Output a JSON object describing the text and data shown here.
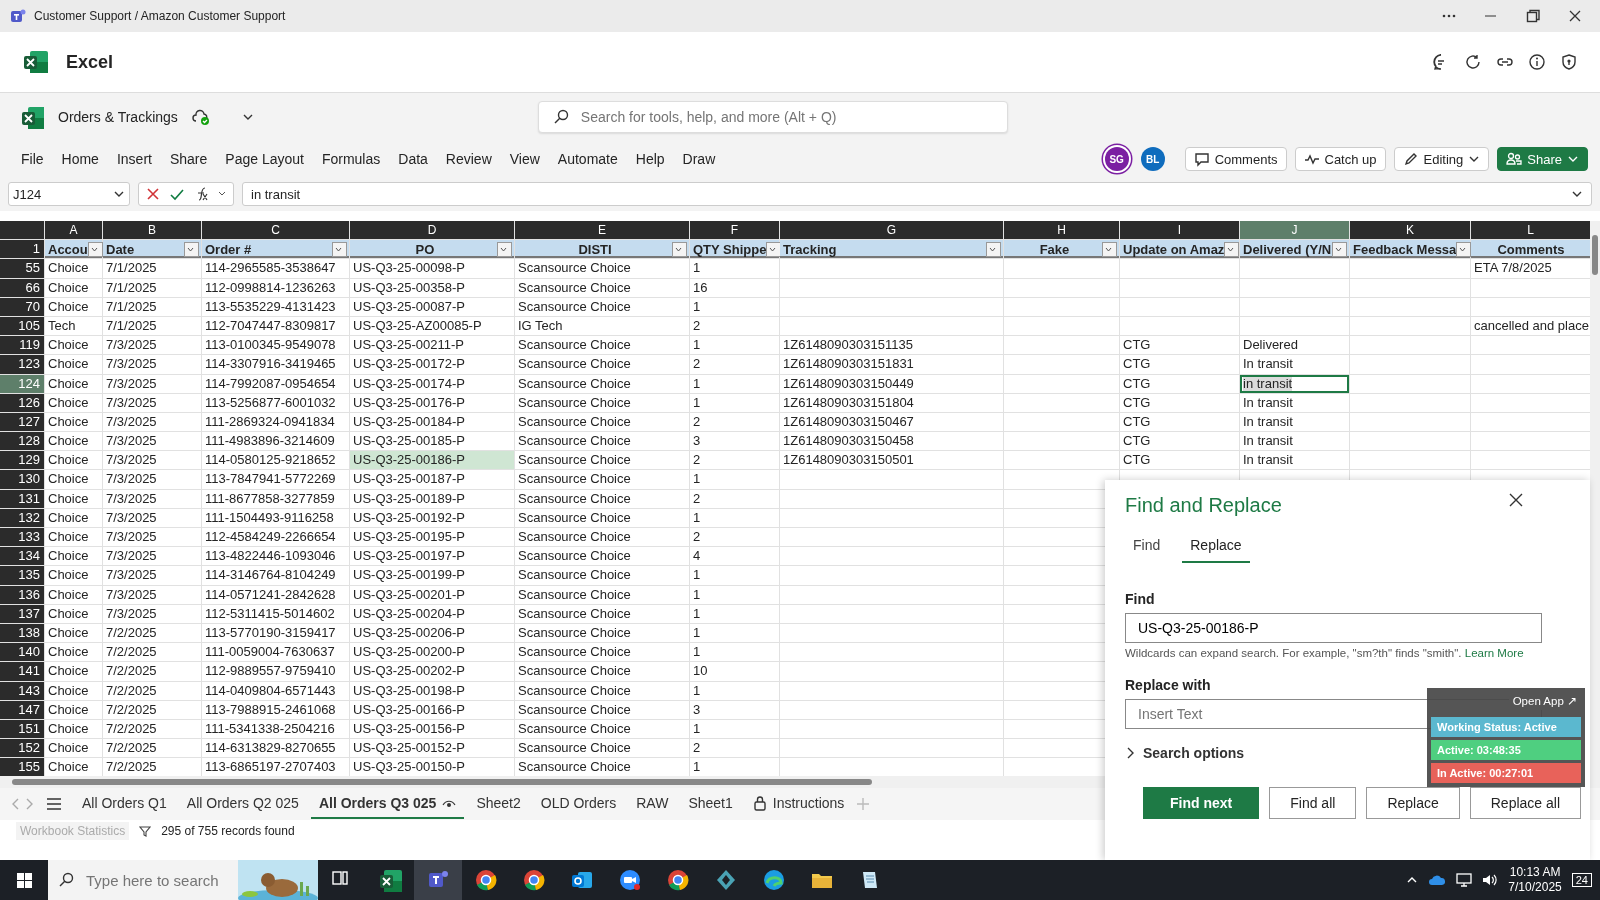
{
  "window": {
    "title": "Customer Support / Amazon Customer Support"
  },
  "app": {
    "name": "Excel"
  },
  "document": {
    "name": "Orders & Trackings",
    "search": {
      "placeholder": "Search for tools, help, and more (Alt + Q)"
    }
  },
  "menu": [
    {
      "label": "File"
    },
    {
      "label": "Home"
    },
    {
      "label": "Insert"
    },
    {
      "label": "Share"
    },
    {
      "label": "Page Layout"
    },
    {
      "label": "Formulas"
    },
    {
      "label": "Data"
    },
    {
      "label": "Review"
    },
    {
      "label": "View"
    },
    {
      "label": "Automate"
    },
    {
      "label": "Help"
    },
    {
      "label": "Draw"
    }
  ],
  "avatars": [
    {
      "initials": "SG",
      "color": "#7b1fa2"
    },
    {
      "initials": "BL",
      "color": "#0f6cbd"
    }
  ],
  "actions": [
    {
      "label": "Comments",
      "kind": "comment"
    },
    {
      "label": "Catch up",
      "kind": "pulse"
    },
    {
      "label": "Editing",
      "kind": "pencil"
    },
    {
      "label": "Share",
      "kind": "share"
    }
  ],
  "formula_bar": {
    "cell": "J124",
    "value": "in transit"
  },
  "sheet": {
    "columns": [
      {
        "letter": "A",
        "selected": false
      },
      {
        "letter": "B",
        "selected": false
      },
      {
        "letter": "C",
        "selected": false
      },
      {
        "letter": "D",
        "selected": false
      },
      {
        "letter": "E",
        "selected": false
      },
      {
        "letter": "F",
        "selected": false
      },
      {
        "letter": "G",
        "selected": false
      },
      {
        "letter": "H",
        "selected": false
      },
      {
        "letter": "I",
        "selected": false
      },
      {
        "letter": "J",
        "selected": true
      },
      {
        "letter": "K",
        "selected": false
      },
      {
        "letter": "L",
        "selected": false
      }
    ],
    "header_row": {
      "row": "1",
      "cells": [
        {
          "text": "Accou",
          "filter": true,
          "kind": "left"
        },
        {
          "text": "Date",
          "filter": true,
          "kind": "left"
        },
        {
          "text": "Order #",
          "filter": true,
          "kind": "left"
        },
        {
          "text": "PO",
          "filter": true,
          "kind": "centered"
        },
        {
          "text": "DISTI",
          "filter": true,
          "kind": "centered"
        },
        {
          "text": "QTY Shippe",
          "filter": true,
          "kind": "left"
        },
        {
          "text": "Tracking",
          "filter": true,
          "kind": "left"
        },
        {
          "text": "Fake",
          "filter": true,
          "kind": "centered"
        },
        {
          "text": "Update on Amaz",
          "filter": true,
          "kind": "left"
        },
        {
          "text": "Delivered (Y/N",
          "filter": true,
          "kind": "left"
        },
        {
          "text": "Feedback Messa",
          "filter": true,
          "kind": "left"
        },
        {
          "text": "Comments",
          "filter": false,
          "kind": "centered"
        }
      ]
    },
    "rows": [
      {
        "row": "55",
        "selected": false,
        "cells": [
          "Choice",
          "7/1/2025",
          "114-2965585-3538647",
          "US-Q3-25-00098-P",
          "Scansource Choice",
          "1",
          "",
          "",
          "",
          "",
          "",
          "ETA 7/8/2025"
        ]
      },
      {
        "row": "66",
        "selected": false,
        "cells": [
          "Choice",
          "7/1/2025",
          "112-0998814-1236263",
          "US-Q3-25-00358-P",
          "Scansource Choice",
          "16",
          "",
          "",
          "",
          "",
          "",
          ""
        ]
      },
      {
        "row": "70",
        "selected": false,
        "cells": [
          "Choice",
          "7/1/2025",
          "113-5535229-4131423",
          "US-Q3-25-00087-P",
          "Scansource Choice",
          "1",
          "",
          "",
          "",
          "",
          "",
          ""
        ]
      },
      {
        "row": "105",
        "selected": false,
        "cells": [
          "Tech",
          "7/1/2025",
          "112-7047447-8309817",
          "US-Q3-25-AZ00085-P",
          "IG Tech",
          "2",
          "",
          "",
          "",
          "",
          "",
          "cancelled and place"
        ]
      },
      {
        "row": "119",
        "selected": false,
        "cells": [
          "Choice",
          "7/3/2025",
          "113-0100345-9549078",
          "US-Q3-25-00211-P",
          "Scansource Choice",
          "1",
          "1Z6148090303151135",
          "",
          "CTG",
          "Delivered",
          "",
          ""
        ]
      },
      {
        "row": "123",
        "selected": false,
        "cells": [
          "Choice",
          "7/3/2025",
          "114-3307916-3419465",
          "US-Q3-25-00172-P",
          "Scansource Choice",
          "2",
          "1Z6148090303151831",
          "",
          "CTG",
          "In transit",
          "",
          ""
        ]
      },
      {
        "row": "124",
        "selected": true,
        "cells": [
          "Choice",
          "7/3/2025",
          "114-7992087-0954654",
          "US-Q3-25-00174-P",
          "Scansource Choice",
          "1",
          "1Z6148090303150449",
          "",
          "CTG",
          {
            "text": "in transit",
            "active": true
          },
          "",
          ""
        ]
      },
      {
        "row": "126",
        "selected": false,
        "cells": [
          "Choice",
          "7/3/2025",
          "113-5256877-6001032",
          "US-Q3-25-00176-P",
          "Scansource Choice",
          "1",
          "1Z6148090303151804",
          "",
          "CTG",
          "In transit",
          "",
          ""
        ]
      },
      {
        "row": "127",
        "selected": false,
        "cells": [
          "Choice",
          "7/3/2025",
          "111-2869324-0941834",
          "US-Q3-25-00184-P",
          "Scansource Choice",
          "2",
          "1Z6148090303150467",
          "",
          "CTG",
          "In transit",
          "",
          ""
        ]
      },
      {
        "row": "128",
        "selected": false,
        "cells": [
          "Choice",
          "7/3/2025",
          "111-4983896-3214609",
          "US-Q3-25-00185-P",
          "Scansource Choice",
          "3",
          "1Z6148090303150458",
          "",
          "CTG",
          "In transit",
          "",
          ""
        ]
      },
      {
        "row": "129",
        "selected": false,
        "cells": [
          "Choice",
          "7/3/2025",
          "114-0580125-9218652",
          {
            "text": "US-Q3-25-00186-P",
            "found": true
          },
          "Scansource Choice",
          "2",
          "1Z6148090303150501",
          "",
          "CTG",
          "In transit",
          "",
          ""
        ]
      },
      {
        "row": "130",
        "selected": false,
        "cells": [
          "Choice",
          "7/3/2025",
          "113-7847941-5772269",
          "US-Q3-25-00187-P",
          "Scansource Choice",
          "1",
          "",
          "",
          "",
          "",
          "",
          ""
        ]
      },
      {
        "row": "131",
        "selected": false,
        "cells": [
          "Choice",
          "7/3/2025",
          "111-8677858-3277859",
          "US-Q3-25-00189-P",
          "Scansource Choice",
          "2",
          "",
          "",
          "",
          "",
          "",
          ""
        ]
      },
      {
        "row": "132",
        "selected": false,
        "cells": [
          "Choice",
          "7/3/2025",
          "111-1504493-9116258",
          "US-Q3-25-00192-P",
          "Scansource Choice",
          "1",
          "",
          "",
          "",
          "",
          "",
          ""
        ]
      },
      {
        "row": "133",
        "selected": false,
        "cells": [
          "Choice",
          "7/3/2025",
          "112-4584249-2266654",
          "US-Q3-25-00195-P",
          "Scansource Choice",
          "2",
          "",
          "",
          "",
          "",
          "",
          ""
        ]
      },
      {
        "row": "134",
        "selected": false,
        "cells": [
          "Choice",
          "7/3/2025",
          "113-4822446-1093046",
          "US-Q3-25-00197-P",
          "Scansource Choice",
          "4",
          "",
          "",
          "",
          "",
          "",
          ""
        ]
      },
      {
        "row": "135",
        "selected": false,
        "cells": [
          "Choice",
          "7/3/2025",
          "114-3146764-8104249",
          "US-Q3-25-00199-P",
          "Scansource Choice",
          "1",
          "",
          "",
          "",
          "",
          "",
          ""
        ]
      },
      {
        "row": "136",
        "selected": false,
        "cells": [
          "Choice",
          "7/3/2025",
          "114-0571241-2842628",
          "US-Q3-25-00201-P",
          "Scansource Choice",
          "1",
          "",
          "",
          "",
          "",
          "",
          ""
        ]
      },
      {
        "row": "137",
        "selected": false,
        "cells": [
          "Choice",
          "7/3/2025",
          "112-5311415-5014602",
          "US-Q3-25-00204-P",
          "Scansource Choice",
          "1",
          "",
          "",
          "",
          "",
          "",
          ""
        ]
      },
      {
        "row": "138",
        "selected": false,
        "cells": [
          "Choice",
          "7/2/2025",
          "113-5770190-3159417",
          "US-Q3-25-00206-P",
          "Scansource Choice",
          "1",
          "",
          "",
          "",
          "",
          "",
          ""
        ]
      },
      {
        "row": "140",
        "selected": false,
        "cells": [
          "Choice",
          "7/2/2025",
          "111-0059004-7630637",
          "US-Q3-25-00200-P",
          "Scansource Choice",
          "1",
          "",
          "",
          "",
          "",
          "",
          ""
        ]
      },
      {
        "row": "141",
        "selected": false,
        "cells": [
          "Choice",
          "7/2/2025",
          "112-9889557-9759410",
          "US-Q3-25-00202-P",
          "Scansource Choice",
          "10",
          "",
          "",
          "",
          "",
          "",
          ""
        ]
      },
      {
        "row": "143",
        "selected": false,
        "cells": [
          "Choice",
          "7/2/2025",
          "114-0409804-6571443",
          "US-Q3-25-00198-P",
          "Scansource Choice",
          "1",
          "",
          "",
          "",
          "",
          "",
          ""
        ]
      },
      {
        "row": "147",
        "selected": false,
        "cells": [
          "Choice",
          "7/2/2025",
          "113-7988915-2461068",
          "US-Q3-25-00166-P",
          "Scansource Choice",
          "3",
          "",
          "",
          "",
          "",
          "",
          ""
        ]
      },
      {
        "row": "151",
        "selected": false,
        "cells": [
          "Choice",
          "7/2/2025",
          "111-5341338-2504216",
          "US-Q3-25-00156-P",
          "Scansource Choice",
          "1",
          "",
          "",
          "",
          "",
          "",
          ""
        ]
      },
      {
        "row": "152",
        "selected": false,
        "cells": [
          "Choice",
          "7/2/2025",
          "114-6313829-8270655",
          "US-Q3-25-00152-P",
          "Scansource Choice",
          "2",
          "",
          "",
          "",
          "",
          "",
          ""
        ]
      },
      {
        "row": "155",
        "selected": false,
        "cells": [
          "Choice",
          "7/2/2025",
          "113-6865197-2707403",
          "US-Q3-25-00150-P",
          "Scansource Choice",
          "1",
          "",
          "",
          "",
          "",
          "",
          ""
        ]
      }
    ]
  },
  "sheet_tabs": [
    {
      "label": "All Orders Q1",
      "selected": false,
      "kind": "plain"
    },
    {
      "label": "All Orders Q2 025",
      "selected": false,
      "kind": "plain"
    },
    {
      "label": "All Orders Q3 025",
      "selected": true,
      "kind": "watched"
    },
    {
      "label": "Sheet2",
      "selected": false,
      "kind": "plain"
    },
    {
      "label": "OLD Orders",
      "selected": false,
      "kind": "plain"
    },
    {
      "label": "RAW",
      "selected": false,
      "kind": "plain"
    },
    {
      "label": "Sheet1",
      "selected": false,
      "kind": "plain"
    },
    {
      "label": "Instructions",
      "selected": false,
      "kind": "locked"
    }
  ],
  "status_bar": {
    "statistics": "Workbook Statistics",
    "records": "295 of 755 records found"
  },
  "find_replace": {
    "title": "Find and Replace",
    "tabs": [
      {
        "label": "Find",
        "selected": false
      },
      {
        "label": "Replace",
        "selected": true
      }
    ],
    "find_label": "Find",
    "find_value": "US-Q3-25-00186-P",
    "hint": "Wildcards can expand search. For example, \"sm?th\" finds \"smith\".",
    "hint_link": "Learn More",
    "replace_label": "Replace with",
    "replace": {
      "placeholder": "Insert Text"
    },
    "options": "Search options",
    "buttons": [
      {
        "label": "Find next",
        "kind": "primary"
      },
      {
        "label": "Find all",
        "kind": "secondary"
      },
      {
        "label": "Replace",
        "kind": "secondary"
      },
      {
        "label": "Replace all",
        "kind": "secondary"
      }
    ]
  },
  "tracker": {
    "open": "Open App ↗",
    "items": [
      {
        "text": "Working Status: Active",
        "color": "#5bb8cf"
      },
      {
        "text": "Active: 03:48:35",
        "color": "#4fcf80"
      },
      {
        "text": "In Active: 00:27:01",
        "color": "#e8625a"
      }
    ]
  },
  "taskbar": {
    "search": {
      "placeholder": "Type here to search"
    },
    "apps": [
      {
        "kind": "taskview",
        "selected": false
      },
      {
        "kind": "excel",
        "selected": false
      },
      {
        "kind": "teams",
        "selected": true
      },
      {
        "kind": "chrome",
        "selected": false
      },
      {
        "kind": "chrome",
        "selected": false
      },
      {
        "kind": "outlook",
        "selected": false
      },
      {
        "kind": "zoom",
        "selected": false
      },
      {
        "kind": "chrome",
        "selected": false
      },
      {
        "kind": "diamond",
        "selected": false
      },
      {
        "kind": "edge",
        "selected": false
      },
      {
        "kind": "folder",
        "selected": false
      },
      {
        "kind": "notepad",
        "selected": false
      }
    ],
    "time": "10:13 AM",
    "date": "7/10/2025",
    "notifications": "24"
  }
}
